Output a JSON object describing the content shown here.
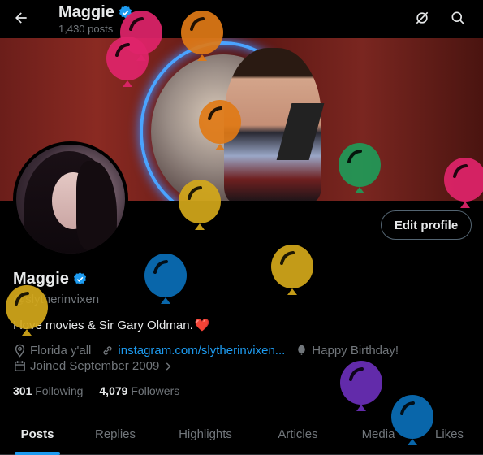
{
  "header": {
    "back_label": "Back",
    "title": "Maggie",
    "post_count": "1,430 posts"
  },
  "profile": {
    "name": "Maggie",
    "handle": "@slytherinvixen",
    "bio_text": "I love movies & Sir Gary Oldman.",
    "bio_emoji": "❤️",
    "location": "Florida y'all",
    "website": "instagram.com/slytherinvixen...",
    "birthday": "Happy Birthday!",
    "joined": "Joined September 2009",
    "following_count": "301",
    "following_label": "Following",
    "followers_count": "4,079",
    "followers_label": "Followers",
    "edit_button": "Edit profile"
  },
  "tabs": [
    {
      "label": "Posts",
      "active": true
    },
    {
      "label": "Replies",
      "active": false
    },
    {
      "label": "Highlights",
      "active": false
    },
    {
      "label": "Articles",
      "active": false
    },
    {
      "label": "Media",
      "active": false
    },
    {
      "label": "Likes",
      "active": false
    }
  ],
  "colors": {
    "accent": "#1d9bf0",
    "verified": "#1d9bf0",
    "muted": "#71767b",
    "balloon_pink": "#e0246a",
    "balloon_orange": "#e07a16",
    "balloon_yellow": "#d4a81a",
    "balloon_blue": "#0a6fb8",
    "balloon_green": "#1f9a58",
    "balloon_purple": "#6a2fb8"
  },
  "icons": [
    "back-arrow-icon",
    "verified-badge-icon",
    "unfollow-grok-icon",
    "search-icon",
    "location-icon",
    "link-icon",
    "balloon-icon",
    "calendar-icon",
    "chevron-right-icon"
  ]
}
